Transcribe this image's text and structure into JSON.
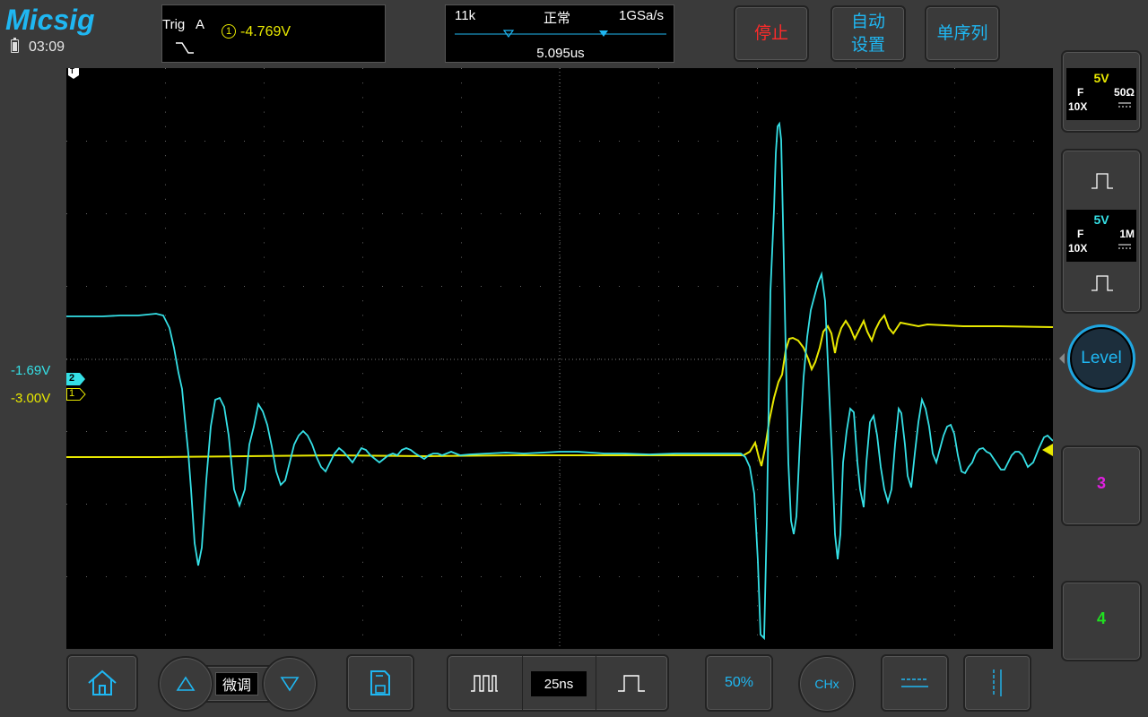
{
  "header": {
    "logo": "Micsig",
    "clock": "03:09"
  },
  "trigger": {
    "label": "Trig",
    "source_letter": "A",
    "channel": "1",
    "level": "-4.769V",
    "edge": "falling-edge-icon"
  },
  "timebase": {
    "memory": "11k",
    "mode": "正常",
    "sample_rate": "1GSa/s",
    "position": "5.095us",
    "scale": "25ns"
  },
  "buttons": {
    "stop": "停止",
    "auto_line1": "自动",
    "auto_line2": "设置",
    "single": "单序列",
    "level": "Level",
    "fine": "微调",
    "fifty_percent": "50%",
    "chx": "CHx"
  },
  "channels": {
    "ch1": {
      "volts": "5V",
      "coupling": "F",
      "impedance": "50Ω",
      "probe": "10X",
      "offset": "-3.00V",
      "color": "#e8e800"
    },
    "ch2": {
      "volts": "5V",
      "coupling": "F",
      "impedance": "1M",
      "probe": "10X",
      "offset": "-1.69V",
      "color": "#35e0e6"
    },
    "ch3": {
      "label": "3",
      "color": "#e020e0"
    },
    "ch4": {
      "label": "4",
      "color": "#20e020"
    }
  },
  "markers": {
    "trigger_time": "T",
    "ch1": "1",
    "ch2": "2"
  },
  "colors": {
    "accent": "#1fb7f2",
    "stop": "#ff2a2a"
  }
}
